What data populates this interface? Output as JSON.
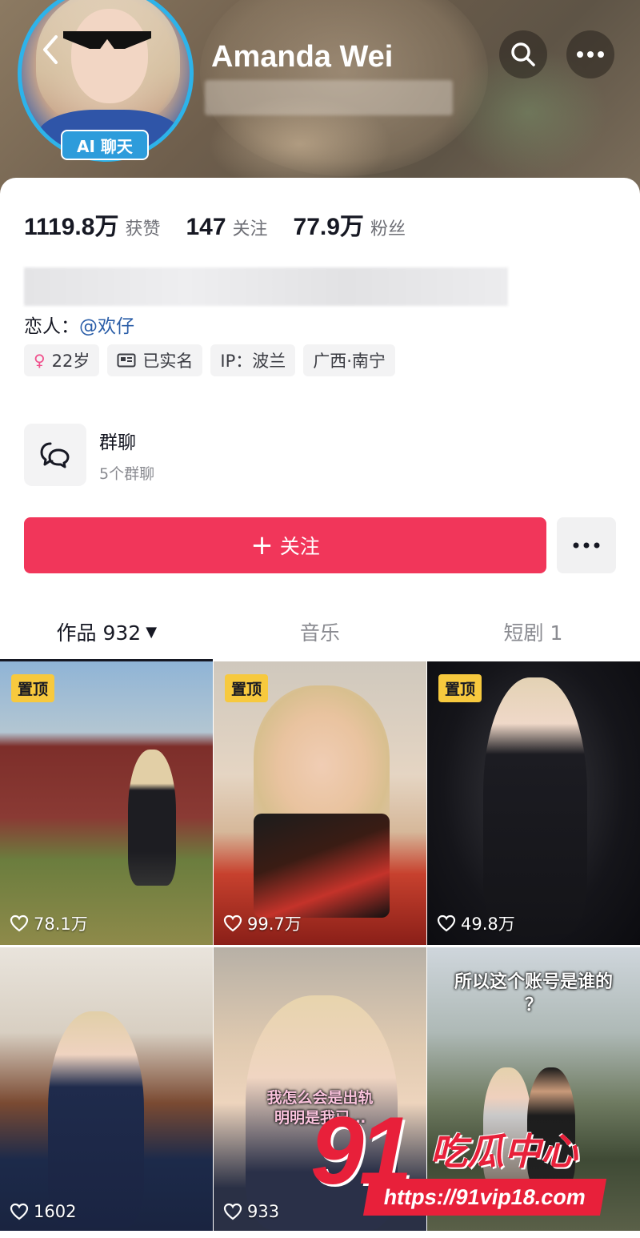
{
  "header": {
    "name": "Amanda Wei",
    "ai_badge": "AI 聊天"
  },
  "stats": [
    {
      "value": "1119.8万",
      "label": "获赞"
    },
    {
      "value": "147",
      "label": "关注"
    },
    {
      "value": "77.9万",
      "label": "粉丝"
    }
  ],
  "profile": {
    "lover_label": "恋人：",
    "lover_mention": "@欢仔",
    "tags": [
      {
        "icon": "female-icon",
        "text": "22岁"
      },
      {
        "icon": "id-card-icon",
        "text": "已实名"
      },
      {
        "icon": "",
        "text": "IP：波兰"
      },
      {
        "icon": "",
        "text": "广西·南宁"
      }
    ]
  },
  "group_chat": {
    "title": "群聊",
    "subtitle": "5个群聊"
  },
  "actions": {
    "follow_label": "关注"
  },
  "tabs": [
    {
      "label": "作品 932",
      "active": true
    },
    {
      "label": "音乐",
      "active": false
    },
    {
      "label": "短剧 1",
      "active": false
    }
  ],
  "videos": [
    {
      "pinned": true,
      "pin_label": "置顶",
      "likes": "78.1万",
      "caption": ""
    },
    {
      "pinned": true,
      "pin_label": "置顶",
      "likes": "99.7万",
      "caption": ""
    },
    {
      "pinned": true,
      "pin_label": "置顶",
      "likes": "49.8万",
      "caption": ""
    },
    {
      "pinned": false,
      "pin_label": "",
      "likes": "1602",
      "caption": ""
    },
    {
      "pinned": false,
      "pin_label": "",
      "likes": "933",
      "caption": "我怎么会是出轨\n明明是我已…"
    },
    {
      "pinned": false,
      "pin_label": "",
      "likes": "",
      "caption": "所以这个账号是谁的\n？"
    }
  ],
  "watermark": {
    "number": "91",
    "text": "吃瓜中心",
    "url": "https://91vip18.com"
  },
  "colors": {
    "follow": "#f1365a",
    "ring": "#2db3ea",
    "pin": "#f7c93e",
    "watermark": "#e8203a"
  }
}
